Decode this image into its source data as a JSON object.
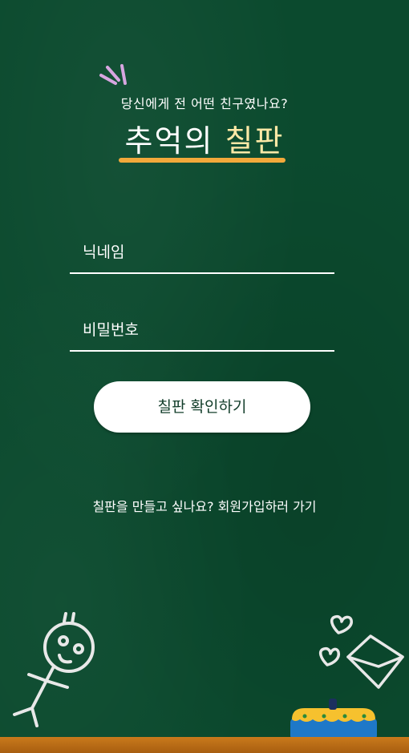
{
  "header": {
    "subtitle": "당신에게 전 어떤 친구였나요?",
    "title_part1": "추억의",
    "title_part2": "칠판"
  },
  "form": {
    "nickname_label": "닉네임",
    "password_label": "비밀번호",
    "confirm_button": "칠판 확인하기"
  },
  "footer": {
    "signup_text": "칠판을 만들고 싶나요? 회원가입하러 가기"
  },
  "colors": {
    "board_green": "#0b4a2e",
    "title_highlight": "#ffe9a6",
    "underline_orange": "#f2a93b",
    "chalk_ledge": "#b86a12",
    "button_bg": "#ffffff",
    "button_text": "#123d2a"
  },
  "icons": {
    "sparkle": "sparkle-lines-icon",
    "stick_figure": "stick-figure-doodle",
    "hearts": "heart-doodle-icon",
    "envelope": "envelope-doodle-icon",
    "cake": "cake-doodle-icon"
  }
}
